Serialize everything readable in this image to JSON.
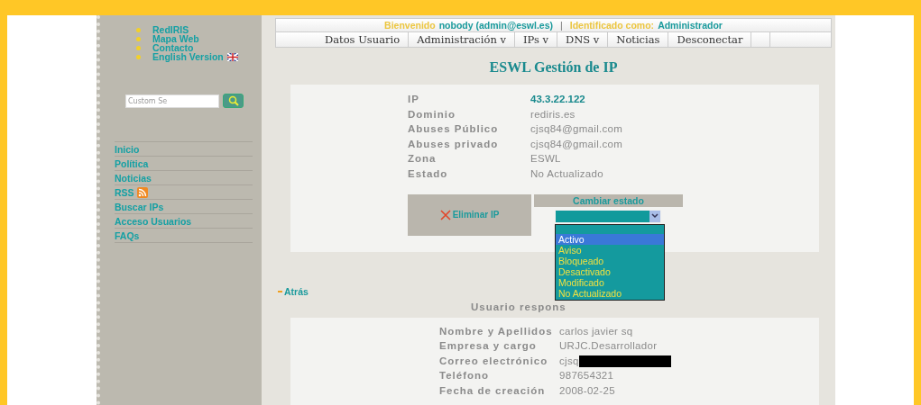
{
  "sidebar": {
    "top_links": [
      {
        "label": "RedIRIS",
        "flag": false
      },
      {
        "label": "Mapa Web",
        "flag": false
      },
      {
        "label": "Contacto",
        "flag": false
      },
      {
        "label": "English Version",
        "flag": true
      }
    ],
    "search": {
      "placeholder": "Custom Se"
    },
    "nav": [
      {
        "label": "Inicio",
        "rss": false
      },
      {
        "label": "Política",
        "rss": false
      },
      {
        "label": "Noticias",
        "rss": false
      },
      {
        "label": "RSS",
        "rss": true
      },
      {
        "label": "Buscar IPs",
        "rss": false
      },
      {
        "label": "Acceso Usuarios",
        "rss": false
      },
      {
        "label": "FAQs",
        "rss": false
      }
    ]
  },
  "header": {
    "welcome_label": "Bienvenido",
    "user": "nobody (admin@eswl.es)",
    "separator": "|",
    "role_label": "Identificado como:",
    "role": "Administrador"
  },
  "menu": [
    {
      "label": "Datos Usuario"
    },
    {
      "label": "Administración v"
    },
    {
      "label": "IPs v"
    },
    {
      "label": "DNS v"
    },
    {
      "label": "Noticias"
    },
    {
      "label": "Desconectar"
    }
  ],
  "title": "ESWL Gestión de IP",
  "ip_details": [
    {
      "label": "IP",
      "value": "43.3.22.122",
      "kind": "link"
    },
    {
      "label": "Dominio",
      "value": "rediris.es",
      "kind": "plain"
    },
    {
      "label": "Abuses Público",
      "value": "cjsq84@gmail.com",
      "kind": "plain"
    },
    {
      "label": "Abuses privado",
      "value": "cjsq84@gmail.com",
      "kind": "plain"
    },
    {
      "label": "Zona",
      "value": "ESWL",
      "kind": "plain"
    },
    {
      "label": "Estado",
      "value": "No Actualizado",
      "kind": "plain"
    }
  ],
  "delete_button": "Eliminar IP",
  "change_state": {
    "heading": "Cambiar estado",
    "options": [
      {
        "label": "Activo",
        "selected": true
      },
      {
        "label": "Aviso",
        "selected": false
      },
      {
        "label": "Bloqueado",
        "selected": false
      },
      {
        "label": "Desactivado",
        "selected": false
      },
      {
        "label": "Modificado",
        "selected": false
      },
      {
        "label": "No Actualizado",
        "selected": false
      }
    ]
  },
  "back_link": "Atrás",
  "user_heading": "Usuario respons",
  "user_details": [
    {
      "label": "Nombre y Apellidos",
      "value": "carlos javier sq",
      "redacted": false
    },
    {
      "label": "Empresa y cargo",
      "value": "URJC.Desarrollador",
      "redacted": false
    },
    {
      "label": "Correo electrónico",
      "value": "cjsq",
      "redacted": true
    },
    {
      "label": "Teléfono",
      "value": "987654321",
      "redacted": false
    },
    {
      "label": "Fecha de creación",
      "value": "2008-02-25",
      "redacted": false
    }
  ]
}
